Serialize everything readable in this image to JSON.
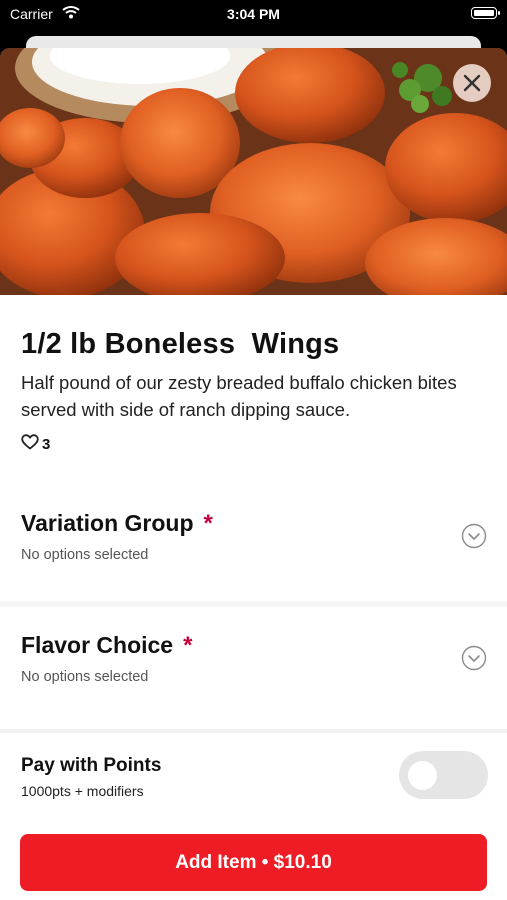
{
  "status_bar": {
    "carrier": "Carrier",
    "time": "3:04 PM"
  },
  "item": {
    "title": "1/2 lb Boneless  Wings",
    "description": "Half pound of our zesty breaded buffalo chicken bites served with side of ranch dipping sauce.",
    "likes": "3",
    "image": "boneless-wings-photo"
  },
  "groups": [
    {
      "title": "Variation Group",
      "required_mark": "*",
      "subtitle": "No options selected"
    },
    {
      "title": "Flavor Choice",
      "required_mark": "*",
      "subtitle": "No options selected"
    }
  ],
  "footer": {
    "points_title": "Pay with Points",
    "points_subtitle": "1000pts + modifiers",
    "toggle_on": false,
    "add_button_label": "Add Item • $10.10"
  },
  "colors": {
    "accent_red": "#ee1c24",
    "required_mark": "#c4003c",
    "toggle_off": "#e5e5e6"
  },
  "icons": [
    "wifi-icon",
    "battery-icon",
    "close-icon",
    "heart-icon",
    "chevron-down-circle-icon"
  ]
}
